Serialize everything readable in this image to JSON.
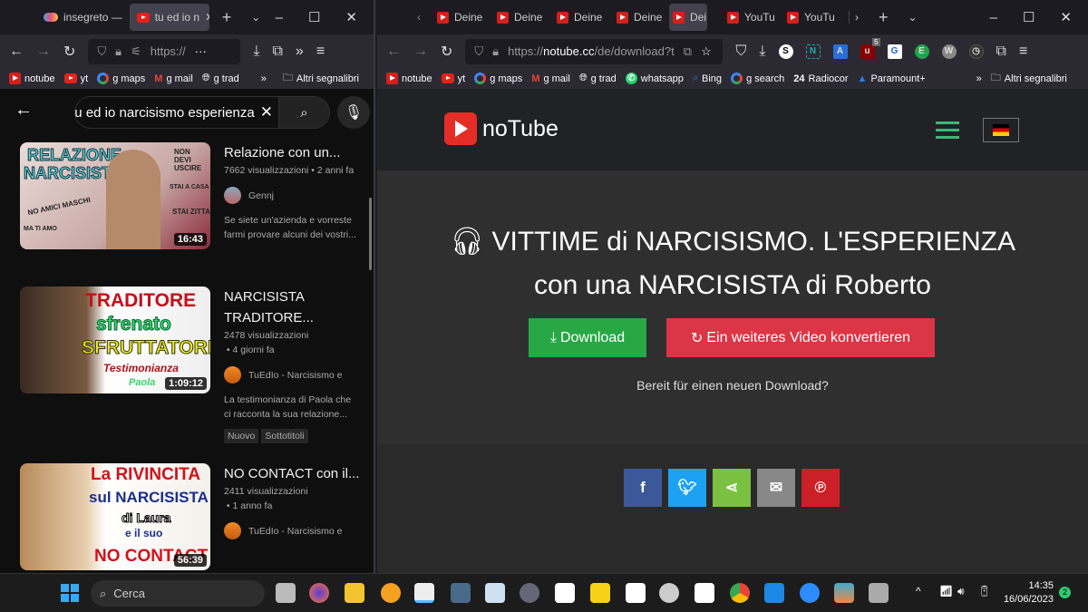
{
  "left_window": {
    "tabs": [
      {
        "label": "insegreto —",
        "active": false
      },
      {
        "label": "tu ed io n",
        "active": true
      }
    ],
    "url": "https://",
    "bookmarks": [
      "notube",
      "yt",
      "g maps",
      "g mail",
      "g trad"
    ],
    "other_bookmarks": "Altri segnalibri",
    "youtube": {
      "search_query": "tu ed io narcisismo esperienza",
      "videos": [
        {
          "title": "Relazione con un...",
          "views": "7662 visualizzazioni",
          "age": "2 anni fa",
          "channel": "Gennj",
          "description": "Se siete un'azienda e vorreste farmi provare alcuni dei vostri...",
          "duration": "16:43",
          "thumb_text": [
            "RELAZIONE",
            "NARCISISTA",
            "NON DEVI USCIRE",
            "STAI A CASA",
            "NO AMICI MASCHI",
            "STAI ZITTA",
            "MA TI AMO"
          ],
          "badges": []
        },
        {
          "title": "NARCISISTA TRADITORE...",
          "views": "2478 visualizzazioni",
          "age": "4 giorni fa",
          "channel": "TuEdIo - Narcisismo e",
          "description": "La testimonianza di Paola che ci racconta la sua relazione...",
          "duration": "1:09:12",
          "thumb_text": [
            "TRADITORE",
            "sfrenato",
            "SFRUTTATORE",
            "Testimonianza",
            "Paola"
          ],
          "badges": [
            "Nuovo",
            "Sottotitoli"
          ]
        },
        {
          "title": "NO CONTACT con il...",
          "views": "2411 visualizzazioni",
          "age": "1 anno fa",
          "channel": "TuEdIo - Narcisismo e",
          "description": "",
          "duration": "56:39",
          "thumb_text": [
            "La RIVINCITA",
            "sul NARCISISTA",
            "di Laura",
            "e il suo",
            "NO CONTACT"
          ],
          "badges": []
        }
      ]
    }
  },
  "right_window": {
    "tabs": [
      {
        "label": "Deine",
        "active": false
      },
      {
        "label": "Deine",
        "active": false
      },
      {
        "label": "Deine",
        "active": false
      },
      {
        "label": "Deine",
        "active": false
      },
      {
        "label": "Dei",
        "active": true
      },
      {
        "label": "YouTu",
        "active": false
      },
      {
        "label": "YouTu",
        "active": false
      }
    ],
    "url_prefix": "https://",
    "url_domain": "notube.cc",
    "url_path": "/de/download?t",
    "extension_badge": "5",
    "bookmarks": [
      "notube",
      "yt",
      "g maps",
      "g mail",
      "g trad",
      "whatsapp",
      "Bing",
      "g search",
      "Radiocor",
      "Paramount+"
    ],
    "other_bookmarks": "Altri segnalibri",
    "notube": {
      "logo": "noTube",
      "title_line1": "VITTIME di NARCISISMO. L'ESPERIENZA",
      "title_line2": "con una NARCISISTA di Roberto",
      "download_label": "Download",
      "convert_label": "Ein weiteres Video konvertieren",
      "ready_text": "Bereit für einen neuen Download?",
      "colors": {
        "download": "#28a745",
        "convert": "#dc3545",
        "menu": "#3cb878"
      },
      "share": [
        {
          "name": "facebook",
          "glyph": "f",
          "color": "#3b5998"
        },
        {
          "name": "twitter",
          "glyph": "t",
          "color": "#1da1f2"
        },
        {
          "name": "share",
          "glyph": "<",
          "color": "#7ac142"
        },
        {
          "name": "email",
          "glyph": "✉",
          "color": "#888888"
        },
        {
          "name": "pinterest",
          "glyph": "P",
          "color": "#cb2027"
        }
      ]
    }
  },
  "taskbar": {
    "search_placeholder": "Cerca",
    "time": "14:35",
    "date": "16/06/2023",
    "notifications": "2"
  }
}
